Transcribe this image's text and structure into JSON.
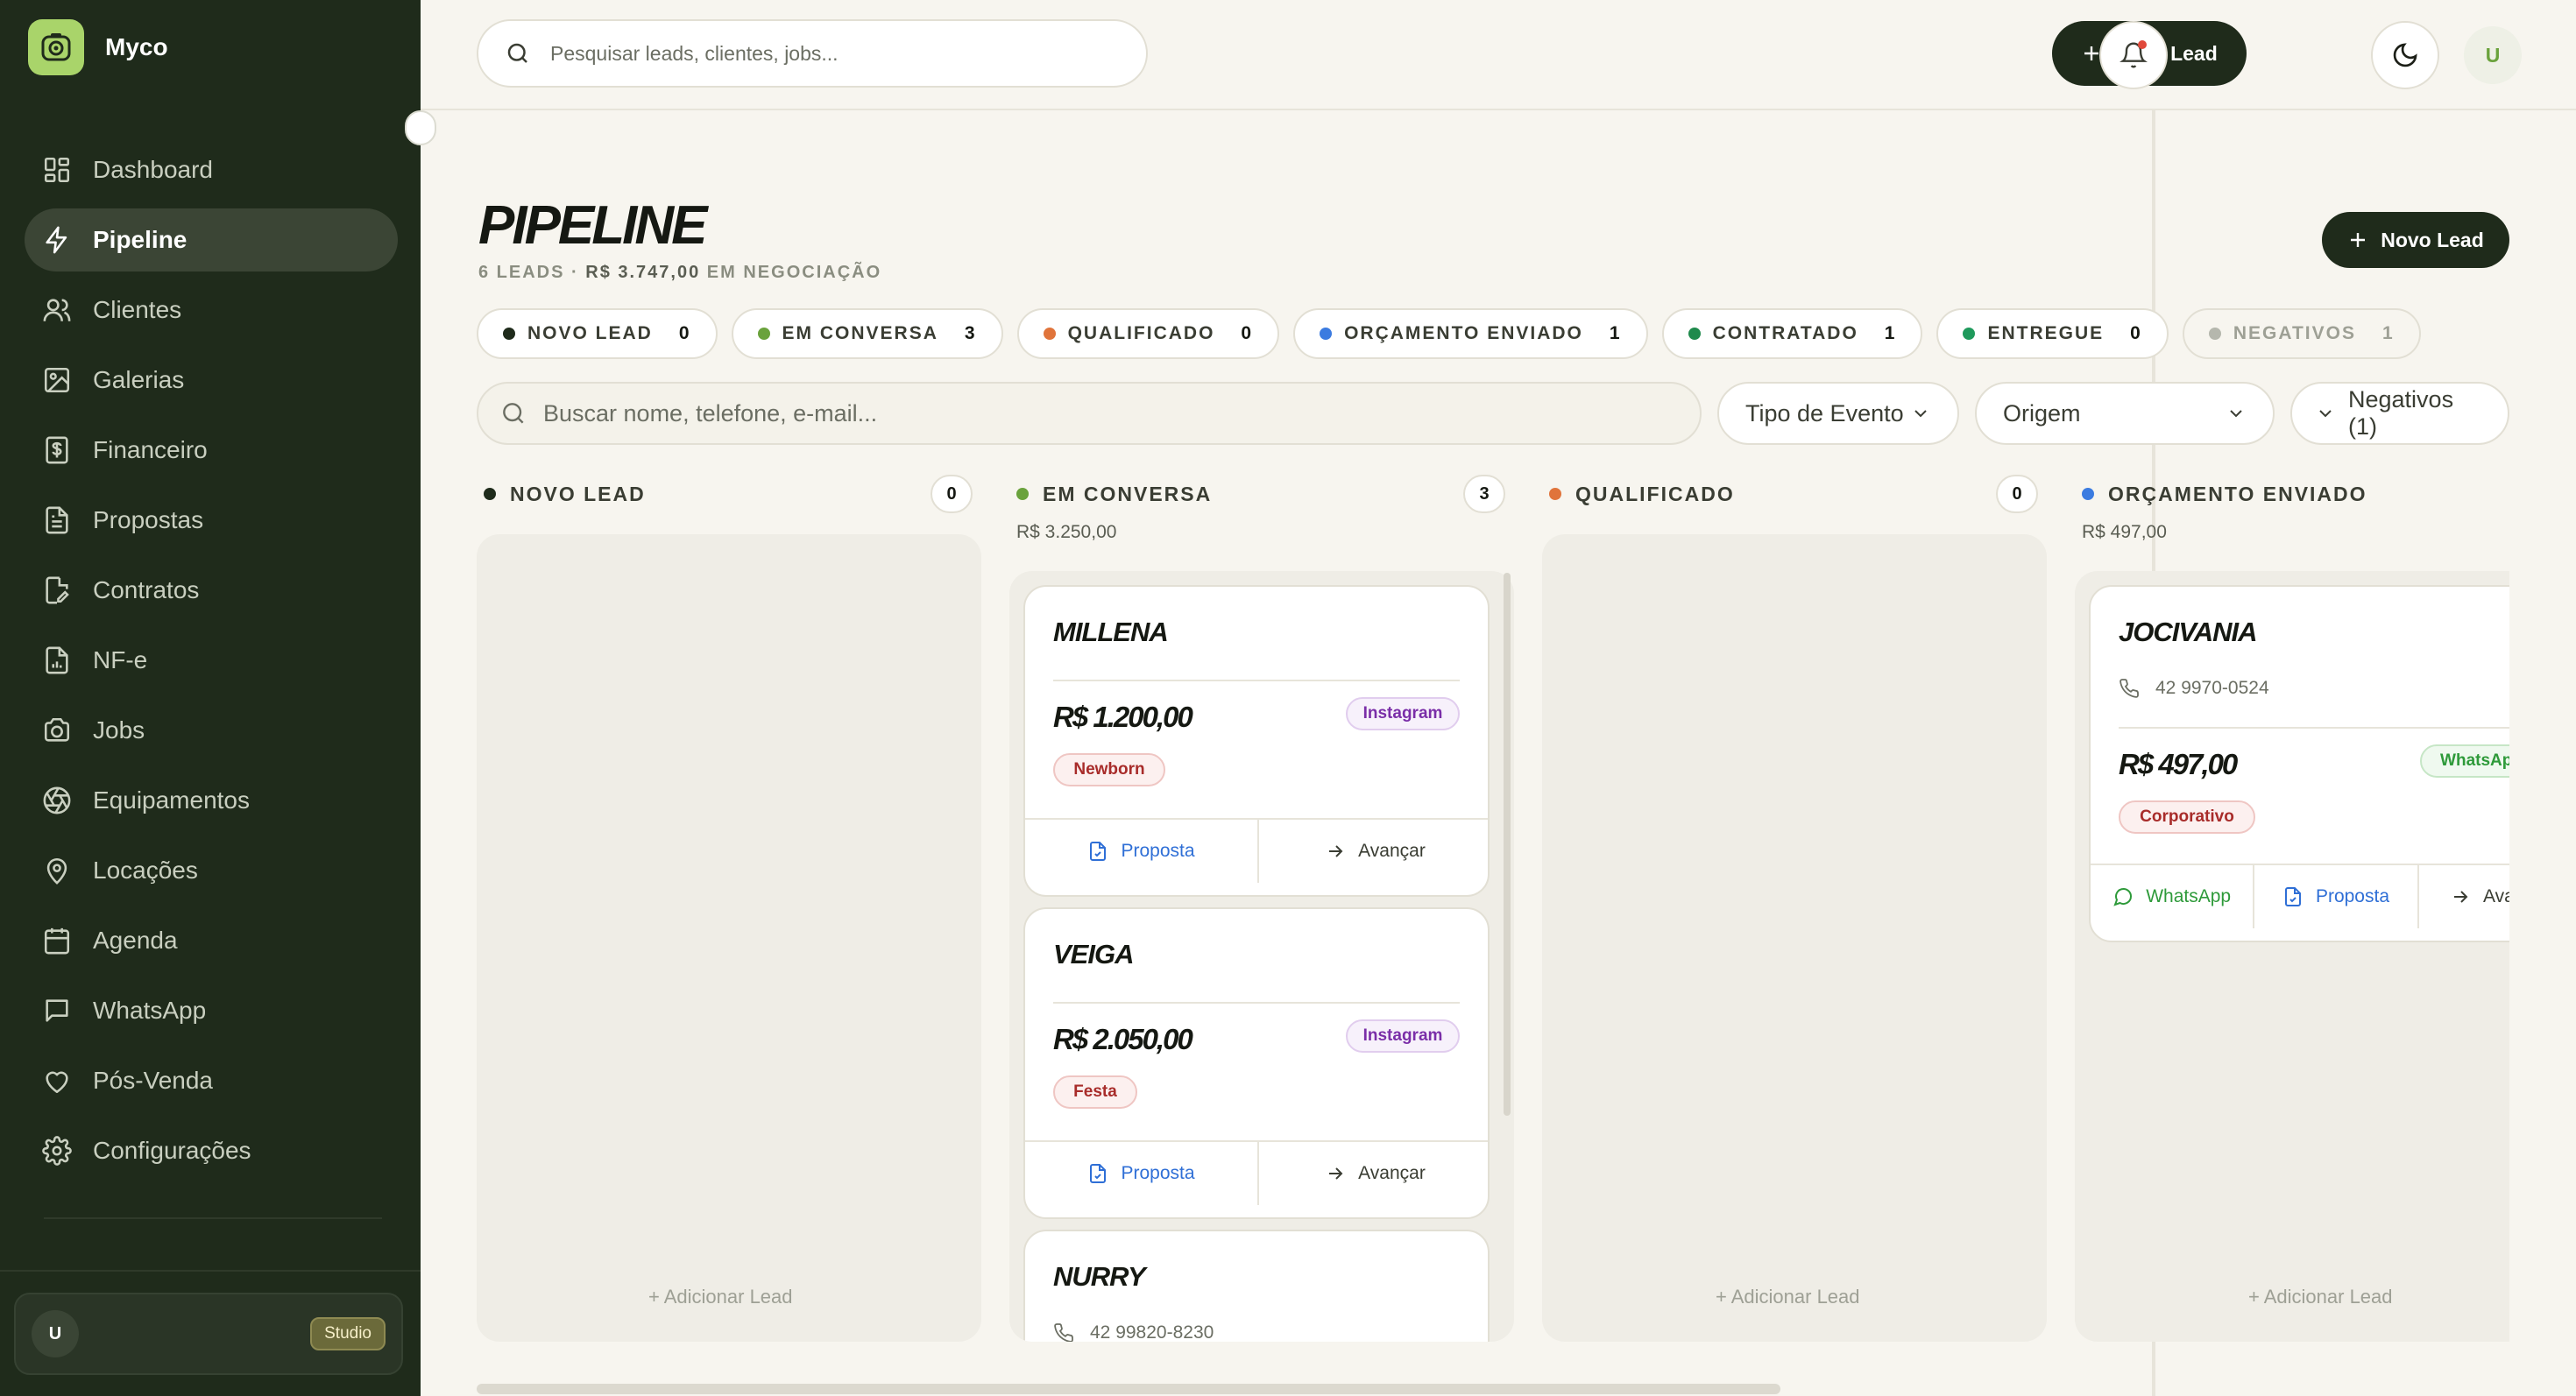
{
  "app": {
    "name": "Myco"
  },
  "sidebar": {
    "items": [
      {
        "label": "Dashboard",
        "icon": "grid-icon",
        "active": false
      },
      {
        "label": "Pipeline",
        "icon": "bolt-icon",
        "active": true
      },
      {
        "label": "Clientes",
        "icon": "users-icon",
        "active": false
      },
      {
        "label": "Galerias",
        "icon": "image-icon",
        "active": false
      },
      {
        "label": "Financeiro",
        "icon": "dollar-doc-icon",
        "active": false
      },
      {
        "label": "Propostas",
        "icon": "document-icon",
        "active": false
      },
      {
        "label": "Contratos",
        "icon": "document-edit-icon",
        "active": false
      },
      {
        "label": "NF-e",
        "icon": "invoice-icon",
        "active": false
      },
      {
        "label": "Jobs",
        "icon": "camera-icon",
        "active": false
      },
      {
        "label": "Equipamentos",
        "icon": "aperture-icon",
        "active": false
      },
      {
        "label": "Locações",
        "icon": "map-pin-icon",
        "active": false
      },
      {
        "label": "Agenda",
        "icon": "calendar-icon",
        "active": false
      },
      {
        "label": "WhatsApp",
        "icon": "chat-icon",
        "active": false
      },
      {
        "label": "Pós-Venda",
        "icon": "heart-icon",
        "active": false
      },
      {
        "label": "Configurações",
        "icon": "gear-icon",
        "active": false
      }
    ],
    "user": {
      "initial": "U",
      "plan": "Studio"
    }
  },
  "topbar": {
    "search_placeholder": "Pesquisar leads, clientes, jobs...",
    "new_lead": "Novo Lead",
    "avatar": "U"
  },
  "header": {
    "title": "PIPELINE",
    "leads": "6 LEADS",
    "sep": " · ",
    "amount": "R$ 3.747,00",
    "suffix": " EM NEGOCIAÇÃO",
    "new_lead": "Novo Lead"
  },
  "chips": [
    {
      "label": "NOVO LEAD",
      "count": "0",
      "color": "#1f2b1b"
    },
    {
      "label": "EM CONVERSA",
      "count": "3",
      "color": "#6aa23c"
    },
    {
      "label": "QUALIFICADO",
      "count": "0",
      "color": "#e0743b"
    },
    {
      "label": "ORÇAMENTO ENVIADO",
      "count": "1",
      "color": "#3b7be0"
    },
    {
      "label": "CONTRATADO",
      "count": "1",
      "color": "#1f8a4c"
    },
    {
      "label": "ENTREGUE",
      "count": "0",
      "color": "#1f9a5c"
    },
    {
      "label": "NEGATIVOS",
      "count": "1",
      "color": "#b5b7ad"
    }
  ],
  "filters": {
    "search_placeholder": "Buscar nome, telefone, e-mail...",
    "event_type": "Tipo de Evento",
    "origin": "Origem",
    "negatives": "Negativos (1)"
  },
  "columns": [
    {
      "label": "NOVO LEAD",
      "count": "0",
      "total": ""
    },
    {
      "label": "EM CONVERSA",
      "count": "3",
      "total": "R$ 3.250,00"
    },
    {
      "label": "QUALIFICADO",
      "count": "0",
      "total": ""
    },
    {
      "label": "ORÇAMENTO ENVIADO",
      "count": "",
      "total": "R$ 497,00"
    }
  ],
  "add_lead": "+ Adicionar Lead",
  "cards": {
    "millena": {
      "name": "MILLENA",
      "value": "R$ 1.200,00",
      "origin": "Instagram",
      "tag": "Newborn"
    },
    "veiga": {
      "name": "VEIGA",
      "value": "R$ 2.050,00",
      "origin": "Instagram",
      "tag": "Festa"
    },
    "nurry": {
      "name": "NURRY",
      "phone": "42 99820-8230"
    },
    "jocivania": {
      "name": "JOCIVANIA",
      "phone": "42 9970-0524",
      "value": "R$ 497,00",
      "origin": "WhatsApp",
      "tag": "Corporativo"
    }
  },
  "actions": {
    "proposal": "Proposta",
    "advance": "Avançar",
    "whatsapp": "WhatsApp"
  },
  "colors": {
    "sidebar_bg": "#1f2b1b",
    "accent": "#a9d46a",
    "link_blue": "#2f6fd6"
  }
}
